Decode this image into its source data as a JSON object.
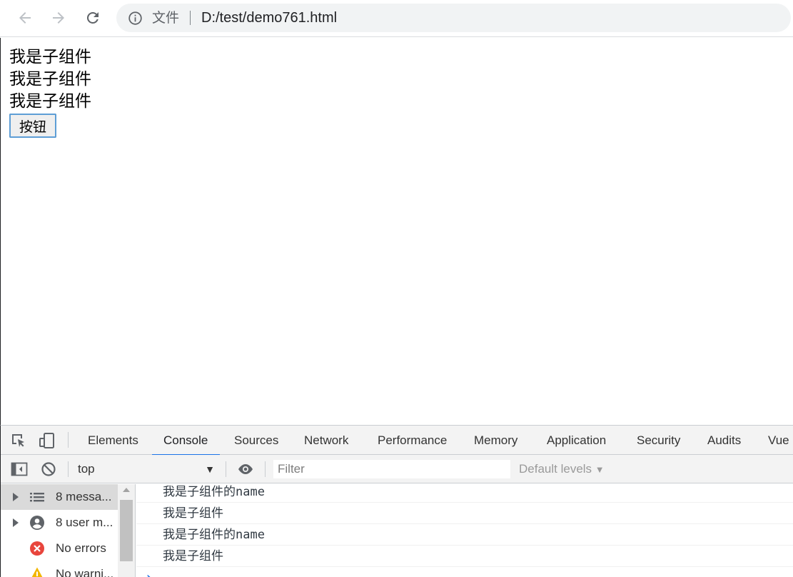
{
  "browser": {
    "scheme_label": "文件",
    "url": "D:/test/demo761.html"
  },
  "page": {
    "child_lines": [
      "我是子组件",
      "我是子组件",
      "我是子组件"
    ],
    "button_label": "按钮"
  },
  "devtools": {
    "tabs": [
      "Elements",
      "Console",
      "Sources",
      "Network",
      "Performance",
      "Memory",
      "Application",
      "Security",
      "Audits",
      "Vue"
    ],
    "active_tab": "Console",
    "context": "top",
    "filter_placeholder": "Filter",
    "levels": "Default levels",
    "sidebar": [
      {
        "label": "8 messa...",
        "icon": "list-icon"
      },
      {
        "label": "8 user m...",
        "icon": "user-icon"
      },
      {
        "label": "No errors",
        "icon": "error-icon"
      },
      {
        "label": "No warni...",
        "icon": "warning-icon"
      }
    ],
    "messages": [
      "我是子组件的name",
      "我是子组件",
      "我是子组件的name",
      "我是子组件"
    ]
  },
  "colors": {
    "accent": "#1a73e8",
    "error": "#e8453c",
    "warning": "#f2b600"
  }
}
